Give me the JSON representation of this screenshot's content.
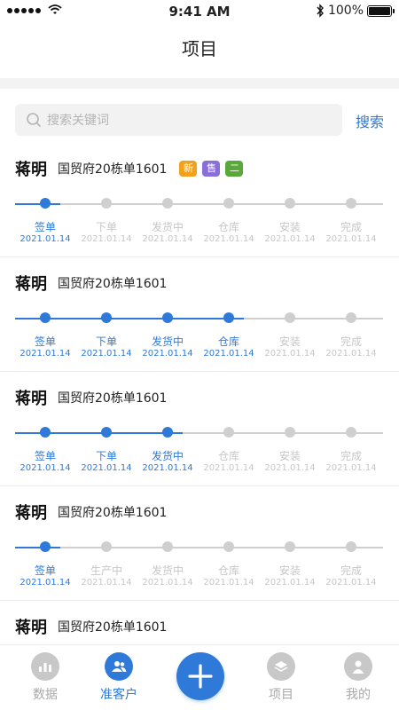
{
  "status_bar": {
    "time": "9:41 AM",
    "battery": "100%"
  },
  "header": {
    "title": "项目"
  },
  "search": {
    "placeholder": "搜索关键词",
    "button_label": "搜索"
  },
  "colors": {
    "accent": "#2f7ad8",
    "inactive": "#c6c6c6",
    "tag_new": "#f3a11b",
    "tag_sale": "#8a6fd8",
    "tag_second": "#5aa839"
  },
  "projects": [
    {
      "name": "蒋明",
      "address": "国贸府20栋单1601",
      "tags": [
        {
          "text": "新",
          "icon": "tag-new"
        },
        {
          "text": "售",
          "icon": "tag-sale"
        },
        {
          "text": "二",
          "icon": "tag-second"
        }
      ],
      "progress_completed": 1,
      "stages": [
        {
          "label": "签单",
          "date": "2021.01.14"
        },
        {
          "label": "下单",
          "date": "2021.01.14"
        },
        {
          "label": "发货中",
          "date": "2021.01.14"
        },
        {
          "label": "仓库",
          "date": "2021.01.14"
        },
        {
          "label": "安装",
          "date": "2021.01.14"
        },
        {
          "label": "完成",
          "date": "2021.01.14"
        }
      ]
    },
    {
      "name": "蒋明",
      "address": "国贸府20栋单1601",
      "tags": [],
      "progress_completed": 4,
      "stages": [
        {
          "label": "签单",
          "date": "2021.01.14"
        },
        {
          "label": "下单",
          "date": "2021.01.14"
        },
        {
          "label": "发货中",
          "date": "2021.01.14"
        },
        {
          "label": "仓库",
          "date": "2021.01.14"
        },
        {
          "label": "安装",
          "date": "2021.01.14"
        },
        {
          "label": "完成",
          "date": "2021.01.14"
        }
      ]
    },
    {
      "name": "蒋明",
      "address": "国贸府20栋单1601",
      "tags": [],
      "progress_completed": 3,
      "stages": [
        {
          "label": "签单",
          "date": "2021.01.14"
        },
        {
          "label": "下单",
          "date": "2021.01.14"
        },
        {
          "label": "发货中",
          "date": "2021.01.14"
        },
        {
          "label": "仓库",
          "date": "2021.01.14"
        },
        {
          "label": "安装",
          "date": "2021.01.14"
        },
        {
          "label": "完成",
          "date": "2021.01.14"
        }
      ]
    },
    {
      "name": "蒋明",
      "address": "国贸府20栋单1601",
      "tags": [],
      "progress_completed": 1,
      "stages": [
        {
          "label": "签单",
          "date": "2021.01.14"
        },
        {
          "label": "生产中",
          "date": "2021.01.14"
        },
        {
          "label": "发货中",
          "date": "2021.01.14"
        },
        {
          "label": "仓库",
          "date": "2021.01.14"
        },
        {
          "label": "安装",
          "date": "2021.01.14"
        },
        {
          "label": "完成",
          "date": "2021.01.14"
        }
      ]
    },
    {
      "name": "蒋明",
      "address": "国贸府20栋单1601",
      "tags": [],
      "progress_completed": 0,
      "stages": []
    }
  ],
  "tabbar": {
    "items": [
      {
        "label": "数据",
        "icon": "chart-icon",
        "active": false
      },
      {
        "label": "准客户",
        "icon": "users-icon",
        "active": true
      },
      {
        "label": "项目",
        "icon": "layers-icon",
        "active": false
      },
      {
        "label": "我的",
        "icon": "user-icon",
        "active": false
      }
    ],
    "add_icon": "plus-icon"
  }
}
